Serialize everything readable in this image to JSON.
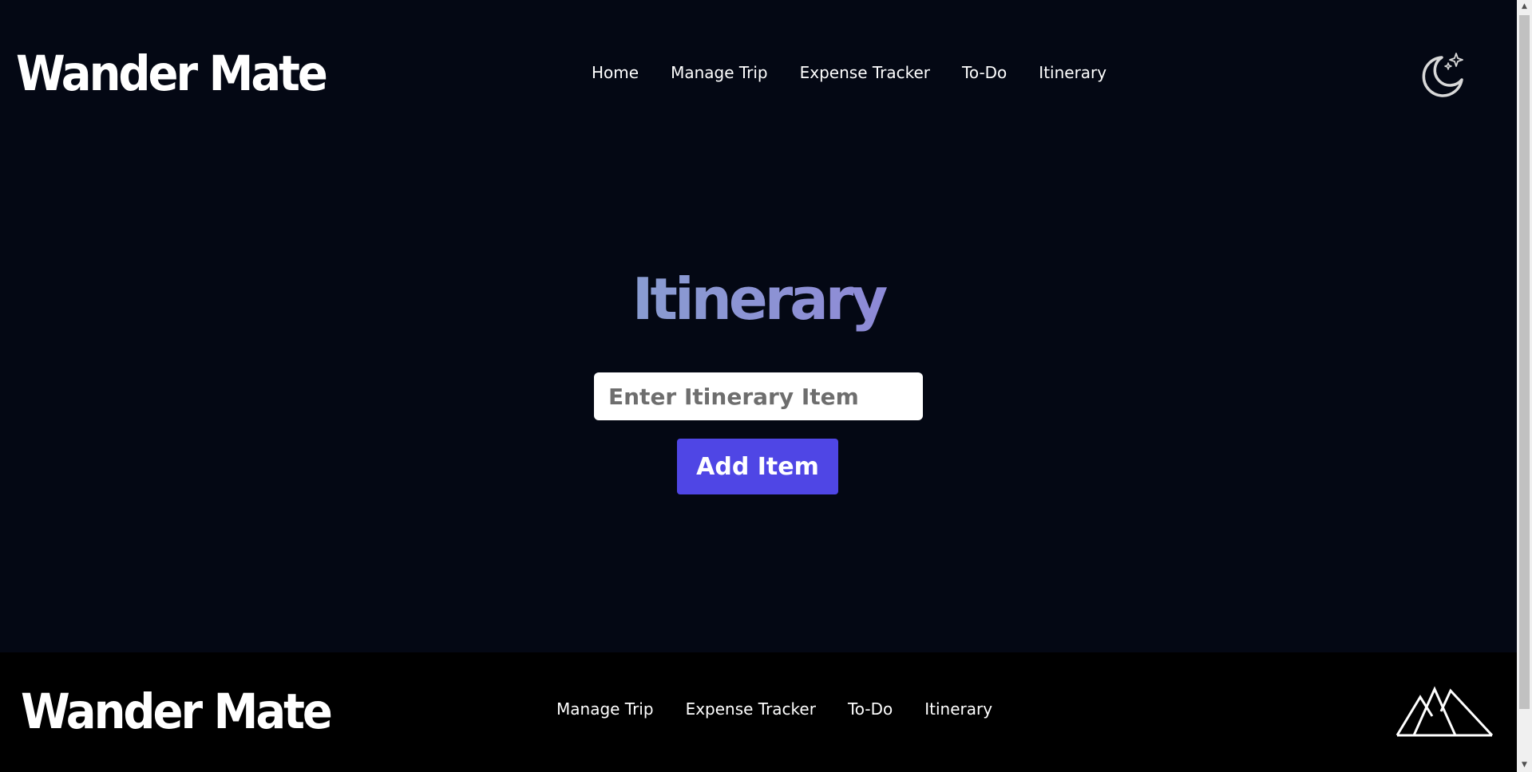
{
  "header": {
    "logo_text": "Wander Mate",
    "nav": [
      {
        "label": "Home"
      },
      {
        "label": "Manage Trip"
      },
      {
        "label": "Expense Tracker"
      },
      {
        "label": "To-Do"
      },
      {
        "label": "Itinerary"
      }
    ],
    "theme_toggle_icon": "moon-stars-icon"
  },
  "main": {
    "title": "Itinerary",
    "input": {
      "placeholder": "Enter Itinerary Item",
      "value": ""
    },
    "add_button_label": "Add Item"
  },
  "footer": {
    "logo_text": "Wander Mate",
    "nav": [
      {
        "label": "Manage Trip"
      },
      {
        "label": "Expense Tracker"
      },
      {
        "label": "To-Do"
      },
      {
        "label": "Itinerary"
      }
    ],
    "brand_icon": "mountains-icon"
  },
  "colors": {
    "background": "#040814",
    "footer_background": "#000000",
    "accent": "#4f46e5",
    "title_gradient": [
      "#78c7c0",
      "#8e8ed6",
      "#7a4fe0"
    ]
  }
}
